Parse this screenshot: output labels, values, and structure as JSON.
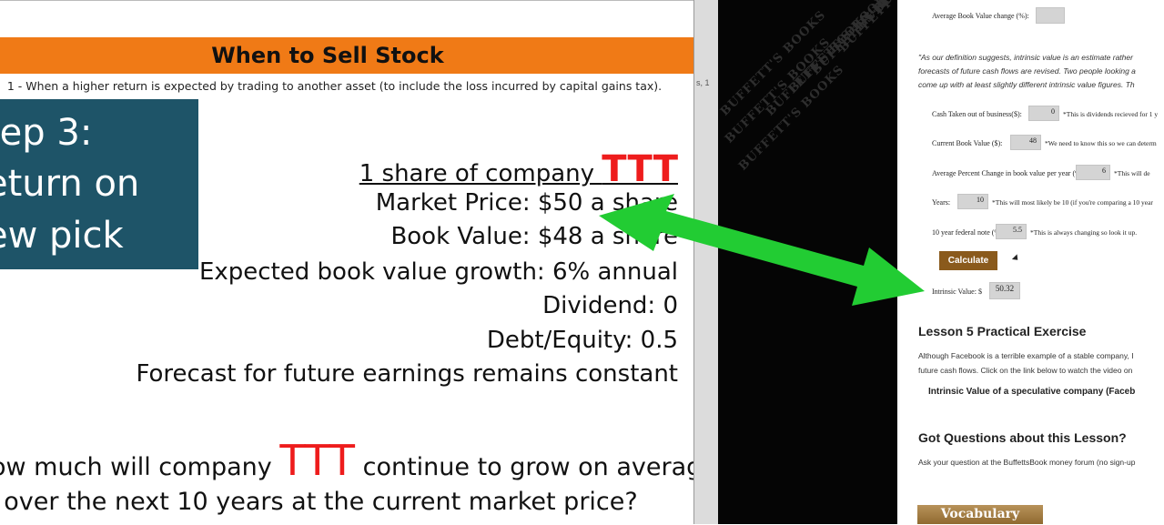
{
  "slide": {
    "title": "When to Sell Stock",
    "subtitle": "1 - When a higher return is expected by trading to another asset (to include the loss incurred by capital gains tax).",
    "step_lines": [
      "tep 3:",
      "eturn on",
      "ew pick"
    ],
    "share_prefix": "1 share of company ",
    "ticker": "TTT",
    "lines": [
      "Market Price: $50 a share",
      "Book Value: $48 a share",
      "Expected book value growth: 6% annual",
      "Dividend: 0",
      "Debt/Equity: 0.5",
      "Forecast for future earnings remains constant"
    ],
    "question_prefix": "ow much will company ",
    "question_suffix": " continue to grow on average",
    "question_line2": "over the next 10 years at the current market price?"
  },
  "mid": {
    "text": "s, 1"
  },
  "book_panel": {
    "text": "BUFFETT'S BOOKS"
  },
  "page": {
    "avg_book_change_label": "Average Book Value change (%):",
    "quote": [
      "\"As our definition suggests, intrinsic value is an estimate rather",
      "forecasts of future cash flows are revised. Two people looking a",
      "come up with at least slightly different intrinsic value figures. Th"
    ],
    "fields": [
      {
        "label": "Cash Taken out of business($):",
        "value": "0",
        "note": "*This is dividends recieved for 1 y"
      },
      {
        "label": "Current Book Value ($):",
        "value": "48",
        "note": "*We need to know this so we can determ"
      },
      {
        "label": "Average Percent Change in book value per year (%):",
        "value": "6",
        "note": "*This will de"
      },
      {
        "label": "Years:",
        "value": "10",
        "note": "*This will most likely be 10 (if you're comparing a 10 year"
      },
      {
        "label": "10 year federal note (%):",
        "value": "5.5",
        "note": "*This is always changing so look it up."
      }
    ],
    "calculate": "Calculate",
    "intrinsic_label": "Intrinsic Value: $",
    "intrinsic_value": "50.32",
    "lesson_heading": "Lesson 5 Practical Exercise",
    "lesson_body": [
      "Although Facebook is a terrible example of a stable company, I",
      "future cash flows. Click on the link below to watch the video on"
    ],
    "lesson_link": "Intrinsic Value of a speculative company (Faceb",
    "questions_heading": "Got Questions about this Lesson?",
    "questions_body": "Ask your question at the BuffettsBook money forum (no sign-up",
    "vocab": "Vocabulary"
  },
  "colors": {
    "slide_header": "#f07a16",
    "step_box": "#1e5468",
    "ticker": "#ee1c1c",
    "arrow": "#22cc33",
    "calc_button": "#8a5a1c"
  }
}
